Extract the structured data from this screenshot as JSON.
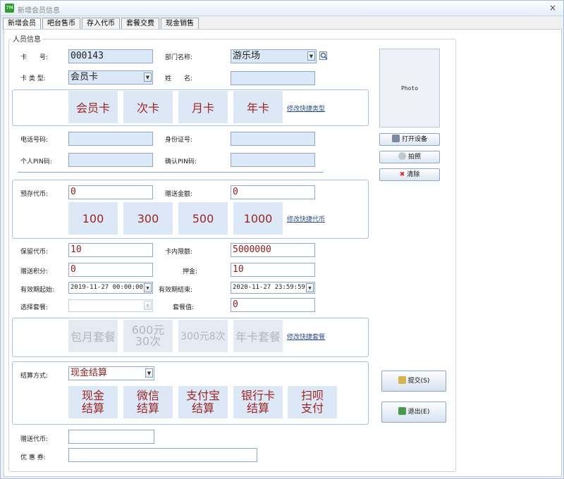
{
  "window": {
    "title": "新增会员信息",
    "app_icon": "7M",
    "close": "×"
  },
  "tabs": [
    {
      "label": "新增会员",
      "active": true
    },
    {
      "label": "吧台售币",
      "active": false
    },
    {
      "label": "存入代币",
      "active": false
    },
    {
      "label": "套餐交费",
      "active": false
    },
    {
      "label": "现金销售",
      "active": false
    }
  ],
  "group": {
    "title": "人员信息"
  },
  "card": {
    "card_no_label": "卡　　号:",
    "card_no": "000143",
    "dept_label": "部门名称:",
    "dept": "游乐场",
    "card_type_label": "卡 类 型:",
    "card_type": "会员卡",
    "name_label": "姓　　名:",
    "name": ""
  },
  "card_types": [
    "会员卡",
    "次卡",
    "月卡",
    "年卡"
  ],
  "card_types_link": "修改快捷类型",
  "contact": {
    "phone_label": "电话号码:",
    "phone": "",
    "id_label": "身份证号:",
    "id": "",
    "pin_label": "个人PIN码:",
    "pin": "",
    "pin_confirm_label": "确认PIN码:",
    "pin_confirm": ""
  },
  "coins": {
    "prestore_label": "预存代币:",
    "prestore": "0",
    "gift_amount_label": "赠送金额:",
    "gift_amount": "0",
    "quick": [
      "100",
      "300",
      "500",
      "1000"
    ],
    "link": "修改快捷代币"
  },
  "limits": {
    "reserve_label": "保留代币:",
    "reserve": "10",
    "card_limit_label": "卡内限额:",
    "card_limit": "5000000",
    "gift_points_label": "赠送积分:",
    "gift_points": "0",
    "deposit_label": "押金:",
    "deposit": "10",
    "valid_from_label": "有效期起始:",
    "valid_from": "2019-11-27 00:00:00",
    "valid_to_label": "有效期结束:",
    "valid_to": "2020-11-27 23:59:59",
    "package_label": "选择套餐:",
    "package": "",
    "package_value_label": "套餐值:",
    "package_value": "0"
  },
  "packages": {
    "items": [
      "包月套餐",
      "600元30次",
      "300元8次",
      "年卡套餐"
    ],
    "link": "修改快捷套餐"
  },
  "payment": {
    "method_label": "结算方式:",
    "method": "现金结算",
    "options": [
      [
        "现金",
        "结算"
      ],
      [
        "微信",
        "结算"
      ],
      [
        "支付宝",
        "结算"
      ],
      [
        "银行卡",
        "结算"
      ],
      [
        "扫呗",
        "支付"
      ]
    ]
  },
  "extra": {
    "gift_coins_label": "赠送代币:",
    "gift_coins": "",
    "coupon_label": "优 惠 券:",
    "coupon": ""
  },
  "side": {
    "photo": "Photo",
    "open_device": "打开设备",
    "take_photo": "拍照",
    "clear": "清除",
    "submit": "提交(S)",
    "exit": "退出(E)"
  },
  "colors": {
    "accent_text": "#9b2525",
    "field_fill": "#dbe8f8",
    "border": "#a9c0dc"
  }
}
